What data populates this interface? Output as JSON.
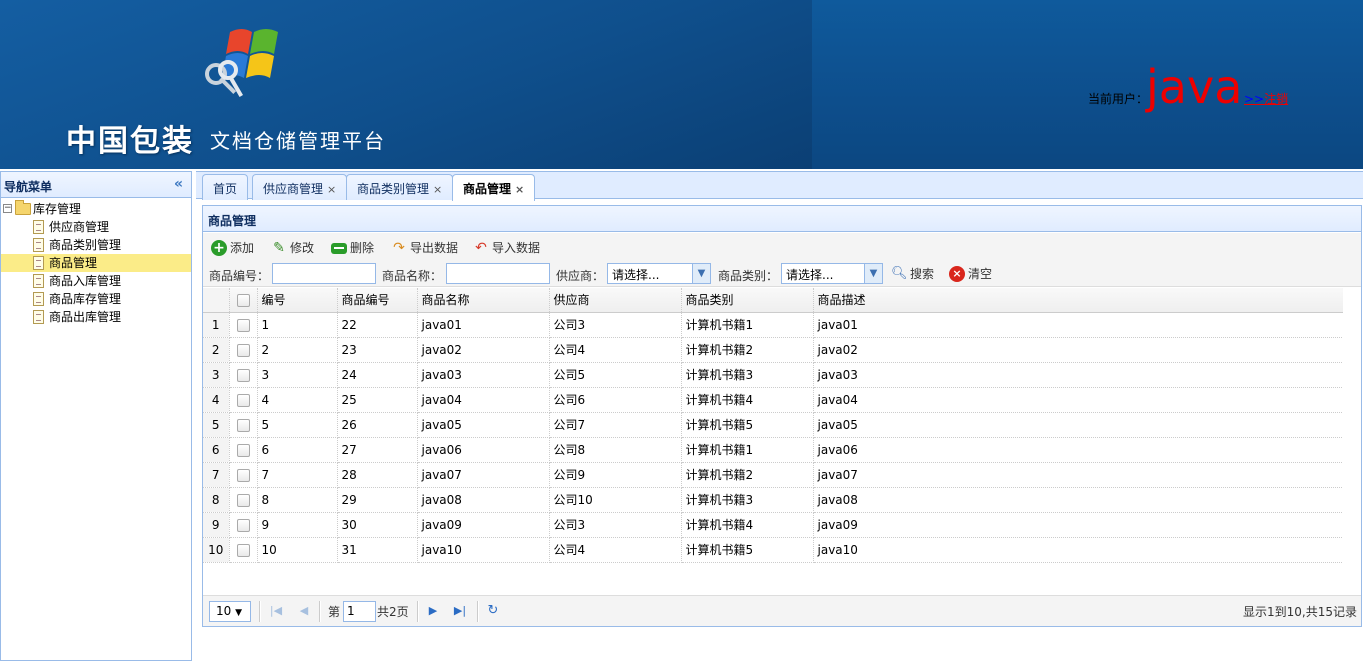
{
  "header": {
    "brand": "中国包装",
    "platform": "文档仓储管理平台",
    "current_user_label": "当前用户：",
    "current_user": "java",
    "logout_arrow": ">>",
    "logout": "注销"
  },
  "nav": {
    "title": "导航菜单",
    "collapse_icon": "«",
    "root": "库存管理",
    "items": [
      "供应商管理",
      "商品类别管理",
      "商品管理",
      "商品入库管理",
      "商品库存管理",
      "商品出库管理"
    ],
    "selected": "商品管理"
  },
  "tabs": [
    {
      "label": "首页",
      "closable": false
    },
    {
      "label": "供应商管理",
      "closable": true
    },
    {
      "label": "商品类别管理",
      "closable": true
    },
    {
      "label": "商品管理",
      "closable": true,
      "active": true
    }
  ],
  "tab_close": "×",
  "panel": {
    "title": "商品管理",
    "toolbar": {
      "add": "添加",
      "edit": "修改",
      "delete": "删除",
      "export": "导出数据",
      "import": "导入数据"
    },
    "filters": {
      "code_label": "商品编号：",
      "name_label": "商品名称：",
      "supplier_label": "供应商：",
      "supplier_value": "请选择...",
      "category_label": "商品类别：",
      "category_value": "请选择...",
      "search": "搜索",
      "clear": "清空"
    }
  },
  "grid": {
    "columns": [
      "编号",
      "商品编号",
      "商品名称",
      "供应商",
      "商品类别",
      "商品描述"
    ],
    "rows": [
      [
        "1",
        "1",
        "22",
        "java01",
        "公司3",
        "计算机书籍1",
        "java01"
      ],
      [
        "2",
        "2",
        "23",
        "java02",
        "公司4",
        "计算机书籍2",
        "java02"
      ],
      [
        "3",
        "3",
        "24",
        "java03",
        "公司5",
        "计算机书籍3",
        "java03"
      ],
      [
        "4",
        "4",
        "25",
        "java04",
        "公司6",
        "计算机书籍4",
        "java04"
      ],
      [
        "5",
        "5",
        "26",
        "java05",
        "公司7",
        "计算机书籍5",
        "java05"
      ],
      [
        "6",
        "6",
        "27",
        "java06",
        "公司8",
        "计算机书籍1",
        "java06"
      ],
      [
        "7",
        "7",
        "28",
        "java07",
        "公司9",
        "计算机书籍2",
        "java07"
      ],
      [
        "8",
        "8",
        "29",
        "java08",
        "公司10",
        "计算机书籍3",
        "java08"
      ],
      [
        "9",
        "9",
        "30",
        "java09",
        "公司3",
        "计算机书籍4",
        "java09"
      ],
      [
        "10",
        "10",
        "31",
        "java10",
        "公司4",
        "计算机书籍5",
        "java10"
      ]
    ]
  },
  "pager": {
    "page_size": "10",
    "page_label": "第",
    "page_value": "1",
    "total_pages": "共2页",
    "summary": "显示1到10,共15记录"
  }
}
